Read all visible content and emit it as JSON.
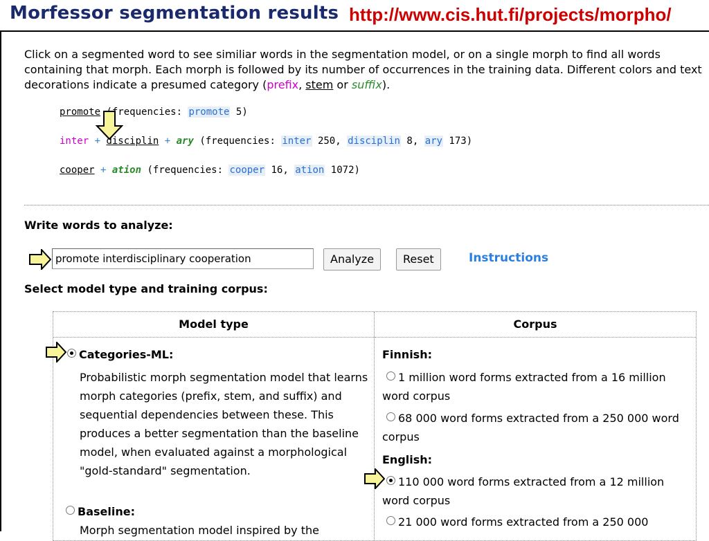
{
  "header": {
    "title": "Morfessor segmentation results",
    "url": "http://www.cis.hut.fi/projects/morpho/"
  },
  "intro": {
    "line": "Click on a segmented word to see similiar words in the segmentation model, or on a single morph to find all words containing that morph. Each morph is followed by its number of occurrences in the training data. Different colors and text decorations indicate a presumed category (",
    "prefix": "prefix",
    "sep1": ", ",
    "stem": "stem",
    "sep2": " or ",
    "suffix": "suffix",
    "end": ")."
  },
  "examples": [
    {
      "word": "promote",
      "freq_label": " (frequencies: ",
      "freqs": [
        {
          "morph": "promote",
          "count": "5"
        }
      ]
    },
    {
      "morphs": [
        "inter",
        "disciplin",
        "ary"
      ],
      "freq_label": " (frequencies: ",
      "freqs": [
        {
          "morph": "inter",
          "count": "250"
        },
        {
          "morph": "disciplin",
          "count": "8"
        },
        {
          "morph": "ary",
          "count": "173"
        }
      ]
    },
    {
      "morphs": [
        "cooper",
        "ation"
      ],
      "freq_label": " (frequencies: ",
      "freqs": [
        {
          "morph": "cooper",
          "count": "16"
        },
        {
          "morph": "ation",
          "count": "1072"
        }
      ]
    }
  ],
  "analyze": {
    "heading": "Write words to analyze:",
    "input_value": "promote interdisciplinary cooperation",
    "analyze_label": "Analyze",
    "reset_label": "Reset",
    "instructions_label": "Instructions"
  },
  "model_select": {
    "heading": "Select model type and training corpus:",
    "col_model": "Model type",
    "col_corpus": "Corpus",
    "models": [
      {
        "label": "Categories-ML:",
        "selected": true,
        "desc": "Probabilistic morph segmentation model that learns morph categories (prefix, stem, and suffix) and sequential dependencies between these. This produces a better segmentation than the baseline model, when evaluated against a morphological \"gold-standard\" segmentation."
      },
      {
        "label": "Baseline:",
        "selected": false,
        "desc": "Morph segmentation model inspired by the"
      }
    ],
    "corpora": [
      {
        "language": "Finnish:",
        "options": [
          {
            "text": "1 million word forms extracted from a 16 million word corpus",
            "selected": false
          },
          {
            "text": "68 000 word forms extracted from a 250 000 word corpus",
            "selected": false
          }
        ]
      },
      {
        "language": "English:",
        "options": [
          {
            "text": "110 000 word forms extracted from a 12 million word corpus",
            "selected": true
          },
          {
            "text": "21 000 word forms extracted from a 250 000",
            "selected": false
          }
        ]
      }
    ]
  },
  "colors": {
    "title": "#1a2a6c",
    "url": "#cc0000",
    "prefix": "#cc00cc",
    "suffix": "#2a8a2a",
    "link": "#2a7fe0",
    "arrow_fill": "#f8f49a"
  },
  "icons": [
    "down-arrow-pointer-icon",
    "right-arrow-pointer-icon",
    "radio-button-icon"
  ]
}
